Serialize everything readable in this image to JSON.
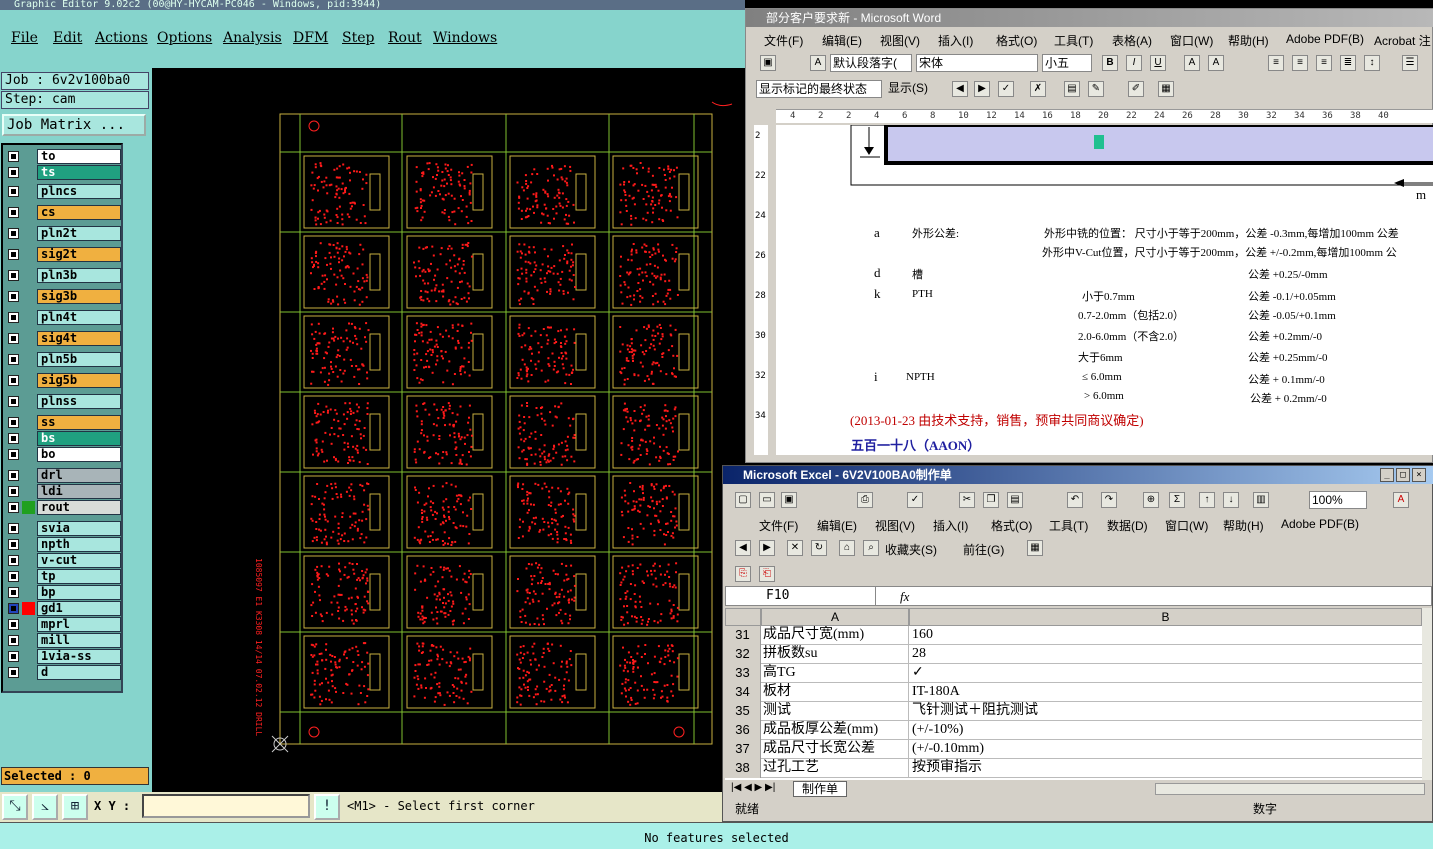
{
  "graphic_editor": {
    "title": "Graphic Editor 9.02c2 (00@HY-HYCAM-PC046 - Windows, pid:3944)",
    "menu": [
      "File",
      "Edit",
      "Actions",
      "Options",
      "Analysis",
      "DFM",
      "Step",
      "Rout",
      "Windows"
    ],
    "job_label": "Job : 6v2v100ba0",
    "step_label": "Step: cam",
    "job_matrix_button": "Job Matrix ...",
    "layers": [
      {
        "name": "to",
        "color": "#ffffff"
      },
      {
        "name": "ts",
        "color": "#20a080"
      },
      {
        "name": "plncs",
        "color": "#a8e6de"
      },
      {
        "name": "cs",
        "color": "#f0b040"
      },
      {
        "name": "pln2t",
        "color": "#a8e6de"
      },
      {
        "name": "sig2t",
        "color": "#f0b040"
      },
      {
        "name": "pln3b",
        "color": "#a8e6de"
      },
      {
        "name": "sig3b",
        "color": "#f0b040"
      },
      {
        "name": "pln4t",
        "color": "#a8e6de"
      },
      {
        "name": "sig4t",
        "color": "#f0b040"
      },
      {
        "name": "pln5b",
        "color": "#a8e6de"
      },
      {
        "name": "sig5b",
        "color": "#f0b040"
      },
      {
        "name": "plnss",
        "color": "#a8e6de"
      },
      {
        "name": "ss",
        "color": "#f0b040"
      },
      {
        "name": "bs",
        "color": "#20a080"
      },
      {
        "name": "bo",
        "color": "#ffffff"
      },
      {
        "name": "drl",
        "color": "#a8b4b8"
      },
      {
        "name": "ldi",
        "color": "#a8b4b8"
      },
      {
        "name": "rout",
        "color": "#d8dcd8"
      },
      {
        "name": "svia",
        "color": "#a8e6de"
      },
      {
        "name": "npth",
        "color": "#a8e6de"
      },
      {
        "name": "v-cut",
        "color": "#a8e6de"
      },
      {
        "name": "tp",
        "color": "#a8e6de"
      },
      {
        "name": "bp",
        "color": "#a8e6de"
      },
      {
        "name": "gd1",
        "color": "#a8e6de"
      },
      {
        "name": "mprl",
        "color": "#a8e6de"
      },
      {
        "name": "mill",
        "color": "#a8e6de"
      },
      {
        "name": "1via-ss",
        "color": "#a8e6de"
      },
      {
        "name": "d",
        "color": "#a8e6de"
      }
    ],
    "selected_label": "Selected : 0",
    "xy_label": "X Y :",
    "prompt": "<M1> - Select first corner",
    "status": "No features selected",
    "drill_text": "1085097 E1 K3308 14/14  07.02.12 DRILL"
  },
  "word": {
    "title": "部分客户要求新 - Microsoft Word",
    "menu": [
      "文件(F)",
      "编辑(E)",
      "视图(V)",
      "插入(I)",
      "格式(O)",
      "工具(T)",
      "表格(A)",
      "窗口(W)",
      "帮助(H)",
      "Adobe PDF(B)",
      "Acrobat 注"
    ],
    "style_combo": "默认段落字(",
    "font_combo": "宋体",
    "size_combo": "小五",
    "markup_combo": "显示标记的最终状态",
    "show_button": "显示(S)",
    "ruler_ticks": [
      "4",
      "2",
      "2",
      "4",
      "6",
      "8",
      "10",
      "12",
      "14",
      "16",
      "18",
      "20",
      "22",
      "24",
      "26",
      "28",
      "30",
      "32",
      "34",
      "36",
      "38",
      "40"
    ],
    "vruler_ticks": [
      "2",
      "22",
      "24",
      "26",
      "28",
      "30",
      "32",
      "34"
    ],
    "doc_lines": {
      "a_label": "a",
      "a_title": "外形公差:",
      "a_line1": "外形中铣的位置： 尺寸小于等于200mm，公差 -0.3mm,每增加100mm 公差",
      "a_line2": "外形中V-Cut位置，尺寸小于等于200mm，公差 +/-0.2mm,每增加100mm 公",
      "d_label": "d",
      "d_title": "槽",
      "d_tol": "公差 +0.25/-0mm",
      "k_label": "k",
      "k_title": "PTH",
      "k_r1_size": "小于0.7mm",
      "k_r1_tol": "公差 -0.1/+0.05mm",
      "k_r2_size": "0.7-2.0mm（包括2.0）",
      "k_r2_tol": "公差  -0.05/+0.1mm",
      "k_r3_size": "2.0-6.0mm（不含2.0）",
      "k_r3_tol": "公差 +0.2mm/-0",
      "k_r4_size": "大于6mm",
      "k_r4_tol": "公差 +0.25mm/-0",
      "i_label": "i",
      "i_title": "NPTH",
      "i_r1_size": "≤ 6.0mm",
      "i_r1_tol": "公差 + 0.1mm/-0",
      "i_r2_size": "> 6.0mm",
      "i_r2_tol": "公差 + 0.2mm/-0",
      "note": "(2013-01-23 由技术支持，销售，预审共同商议确定)",
      "heading": "五百一十八（AAON）",
      "diagram_m": "m"
    }
  },
  "excel": {
    "title": "Microsoft Excel - 6V2V100BA0制作单",
    "menu": [
      "文件(F)",
      "编辑(E)",
      "视图(V)",
      "插入(I)",
      "格式(O)",
      "工具(T)",
      "数据(D)",
      "窗口(W)",
      "帮助(H)",
      "Adobe PDF(B)"
    ],
    "zoom": "100%",
    "favorites": "收藏夹(S)",
    "goto": "前往(G)",
    "name_box": "F10",
    "fx": "fx",
    "columns": [
      "A",
      "B"
    ],
    "rows": [
      {
        "n": "31",
        "a": "成品尺寸宽(mm)",
        "b": "160"
      },
      {
        "n": "32",
        "a": "拼板数su",
        "b": "28"
      },
      {
        "n": "33",
        "a": "高TG",
        "b": "✓"
      },
      {
        "n": "34",
        "a": "板材",
        "b": "IT-180A"
      },
      {
        "n": "35",
        "a": "测试",
        "b": "飞针测试＋阻抗测试"
      },
      {
        "n": "36",
        "a": "成品板厚公差(mm)",
        "b": "(+/-10%)"
      },
      {
        "n": "37",
        "a": "成品尺寸长宽公差",
        "b": "(+/-0.10mm)"
      },
      {
        "n": "38",
        "a": "过孔工艺",
        "b": "按预审指示"
      }
    ],
    "sheet_tab": "制作单",
    "status_ready": "就绪",
    "status_num": "数字"
  }
}
